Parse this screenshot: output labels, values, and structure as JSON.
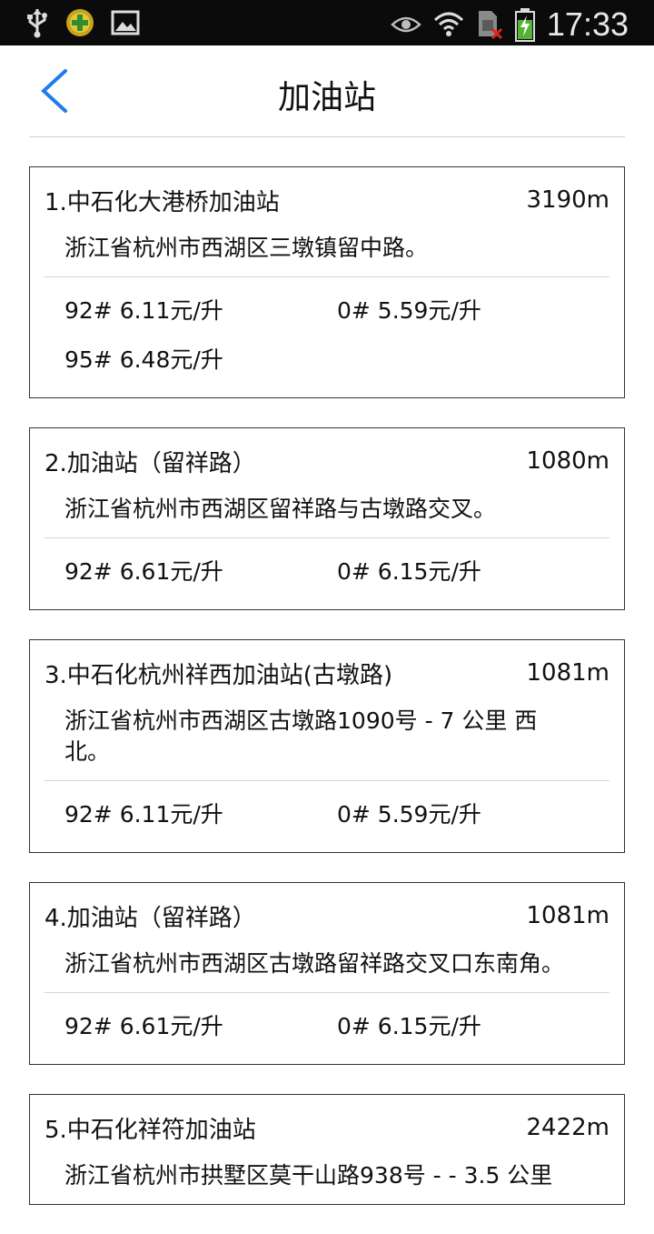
{
  "status_bar": {
    "time": "17:33",
    "icons": [
      "usb-icon",
      "app-plus-icon",
      "image-icon",
      "eye-icon",
      "wifi-icon",
      "sim-error-icon",
      "battery-charging-icon"
    ]
  },
  "header": {
    "title": "加油站",
    "back_icon": "chevron-left-icon"
  },
  "stations": [
    {
      "name": "1.中石化大港桥加油站",
      "distance": "3190m",
      "address": "浙江省杭州市西湖区三墩镇留中路。",
      "prices": [
        "92# 6.11元/升",
        "0# 5.59元/升",
        "95# 6.48元/升"
      ]
    },
    {
      "name": "2.加油站（留祥路）",
      "distance": "1080m",
      "address": "浙江省杭州市西湖区留祥路与古墩路交叉。",
      "prices": [
        "92# 6.61元/升",
        "0# 6.15元/升"
      ]
    },
    {
      "name": "3.中石化杭州祥西加油站(古墩路)",
      "distance": "1081m",
      "address": "浙江省杭州市西湖区古墩路1090号 - 7 公里 西北。",
      "prices": [
        "92# 6.11元/升",
        "0# 5.59元/升"
      ]
    },
    {
      "name": "4.加油站（留祥路）",
      "distance": "1081m",
      "address": "浙江省杭州市西湖区古墩路留祥路交叉口东南角。",
      "prices": [
        "92# 6.61元/升",
        "0# 6.15元/升"
      ]
    },
    {
      "name": "5.中石化祥符加油站",
      "distance": "2422m",
      "address": "浙江省杭州市拱墅区莫干山路938号 -  - 3.5 公里",
      "prices": []
    }
  ]
}
